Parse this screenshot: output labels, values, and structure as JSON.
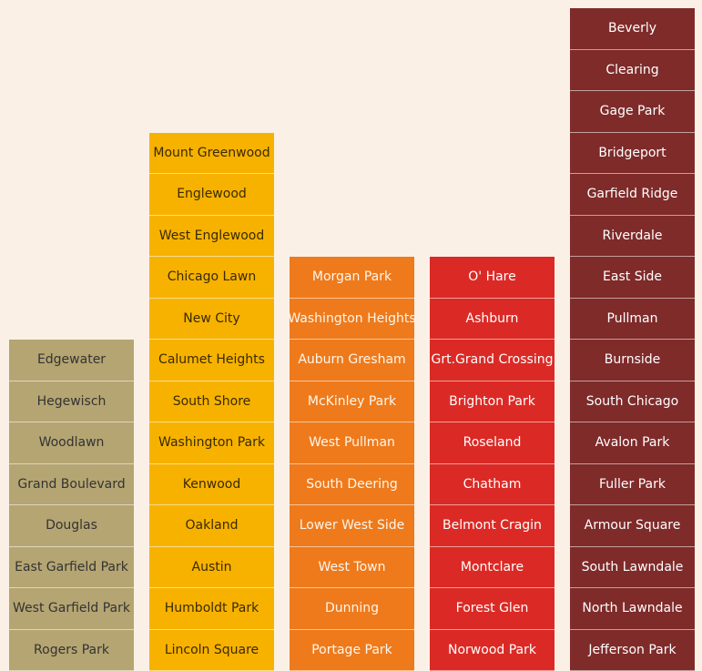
{
  "chart_data": {
    "type": "table",
    "columns": [
      {
        "color": "#B5A572",
        "text_color": "#333333",
        "items": [
          "Edgewater",
          "Hegewisch",
          "Woodlawn",
          "Grand Boulevard",
          "Douglas",
          "East Garfield Park",
          "West Garfield Park",
          "Rogers Park"
        ]
      },
      {
        "color": "#F7B200",
        "text_color": "#3a2a00",
        "items": [
          "Mount Greenwood",
          "Englewood",
          "West Englewood",
          "Chicago Lawn",
          "New City",
          "Calumet Heights",
          "South Shore",
          "Washington Park",
          "Kenwood",
          "Oakland",
          "Austin",
          "Humboldt Park",
          "Lincoln Square"
        ]
      },
      {
        "color": "#EE7A1C",
        "text_color": "#FFF6EA",
        "items": [
          "Morgan Park",
          "Washington Heights",
          "Auburn Gresham",
          "McKinley Park",
          "West Pullman",
          "South Deering",
          "Lower West Side",
          "West Town",
          "Dunning",
          "Portage Park"
        ]
      },
      {
        "color": "#DB2A25",
        "text_color": "#FFFFFF",
        "items": [
          "O' Hare",
          "Ashburn",
          "Grt.Grand Crossing",
          "Brighton Park",
          "Roseland",
          "Chatham",
          "Belmont Cragin",
          "Montclare",
          "Forest Glen",
          "Norwood Park"
        ]
      },
      {
        "color": "#7E2B2A",
        "text_color": "#FFFFFF",
        "items": [
          "Beverly",
          "Clearing",
          "Gage Park",
          "Bridgeport",
          "Garfield Ridge",
          "Riverdale",
          "East Side",
          "Pullman",
          "Burnside",
          "South Chicago",
          "Avalon Park",
          "Fuller Park",
          "Armour Square",
          "South Lawndale",
          "North Lawndale",
          "Jefferson Park"
        ]
      }
    ]
  }
}
